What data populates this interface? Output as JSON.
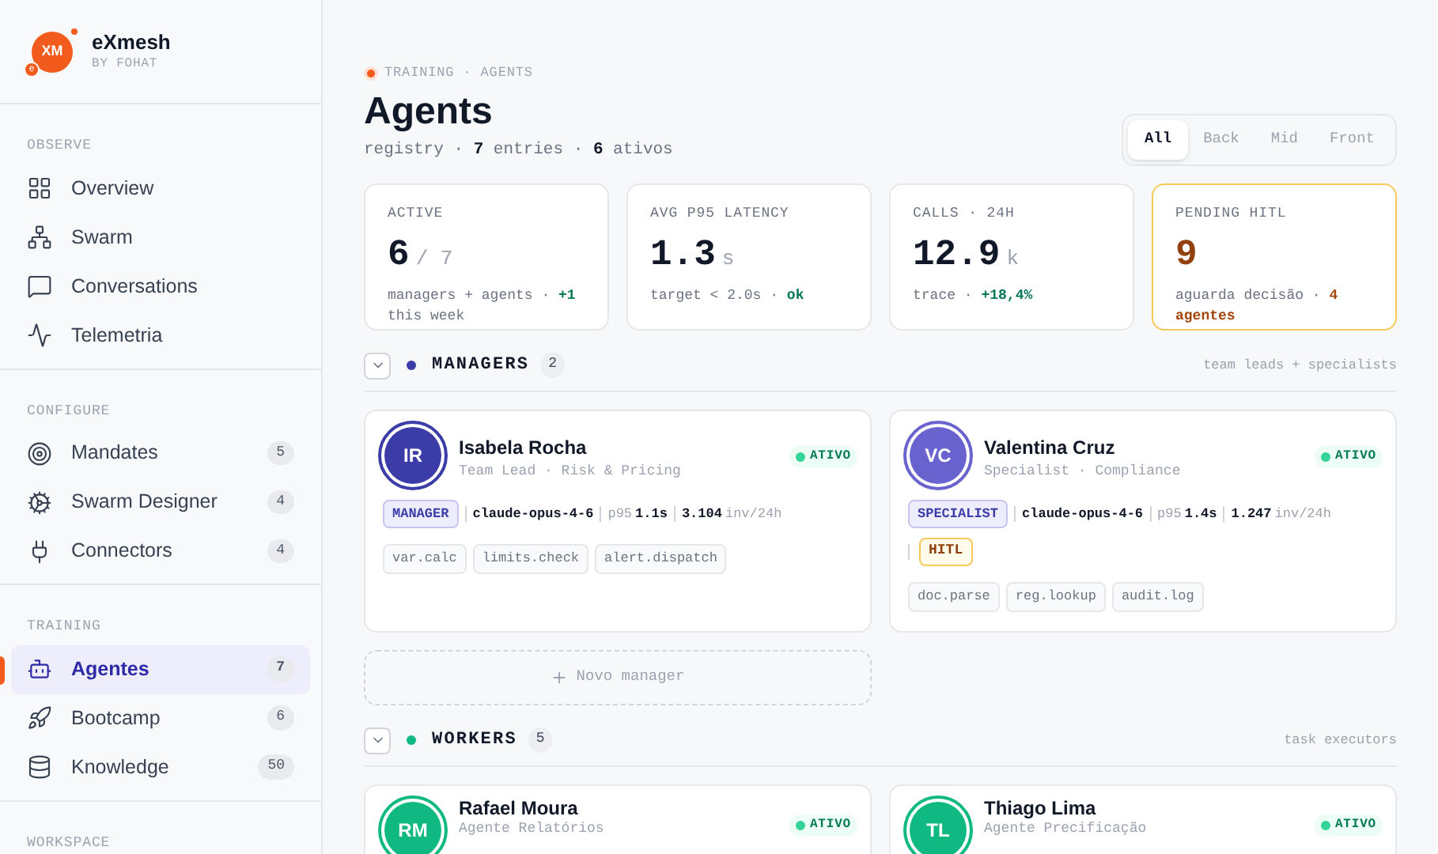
{
  "sidebar": {
    "brand": {
      "logo_text": "XM",
      "logo_badge": "e",
      "name": "eXmesh",
      "byline": "BY FOHAT"
    },
    "sections": [
      {
        "title": "OBSERVE",
        "items": [
          {
            "label": "Overview",
            "selected": false
          },
          {
            "label": "Swarm",
            "selected": false
          },
          {
            "label": "Conversations",
            "selected": false
          },
          {
            "label": "Telemetria",
            "selected": false
          }
        ]
      },
      {
        "title": "CONFIGURE",
        "items": [
          {
            "label": "Mandates",
            "count": "5",
            "selected": false
          },
          {
            "label": "Swarm Designer",
            "count": "4",
            "selected": false
          },
          {
            "label": "Connectors",
            "count": "4",
            "selected": false
          }
        ]
      },
      {
        "title": "TRAINING",
        "items": [
          {
            "label": "Agentes",
            "count": "7",
            "selected": true
          },
          {
            "label": "Bootcamp",
            "count": "6",
            "selected": false
          },
          {
            "label": "Knowledge",
            "count": "50",
            "selected": false
          }
        ]
      },
      {
        "title": "WORKSPACE"
      }
    ]
  },
  "header": {
    "breadcrumb": "TRAINING · AGENTS",
    "title": "Agents",
    "subtitle": "registry · **7** entries · **6** ativos",
    "filters": [
      {
        "label": "All",
        "selected": true
      },
      {
        "label": "Back",
        "selected": false
      },
      {
        "label": "Mid",
        "selected": false
      },
      {
        "label": "Front",
        "selected": false
      }
    ]
  },
  "stats": [
    {
      "label": "ACTIVE",
      "value": "6",
      "unit": "/ 7",
      "note": "managers + agents ·",
      "delta": "+1",
      "note_end": "this week",
      "color": "#047857",
      "highlighted": false
    },
    {
      "label": "AVG P95 LATENCY",
      "value": "1.3",
      "unit": "s",
      "note": "target < 2.0s ·",
      "delta": "ok",
      "color": "#047857",
      "highlighted": false
    },
    {
      "label": "CALLS · 24H",
      "value": "12.9",
      "unit": "k",
      "note": "trace ·",
      "delta": "+18,4%",
      "color": "#047857",
      "highlighted": false
    },
    {
      "label": "PENDING HITL",
      "value": "9",
      "note": "aguarda decisão ·",
      "delta": "4 agentes",
      "color": "#a4460c",
      "highlighted": true
    }
  ],
  "groups": [
    {
      "title": "MANAGERS",
      "count": "2",
      "color": "#3c3ca8",
      "expanded": true,
      "hint": "team leads + specialists",
      "add_label": "Novo manager",
      "agents": [
        {
          "initials": "IR",
          "color": "#3c3ca8",
          "name": "Isabela Rocha",
          "role": "Team Lead · Risk & Pricing",
          "status": "ATIVO",
          "tag": "MANAGER",
          "model": "claude-opus-4-6",
          "p95_label": "p95",
          "p95": "1.1s",
          "invocations": "3.104",
          "inv_unit": "inv/24h",
          "hitl": false,
          "tools": [
            "var.calc",
            "limits.check",
            "alert.dispatch"
          ]
        },
        {
          "initials": "VC",
          "color": "#6963d0",
          "name": "Valentina Cruz",
          "role": "Specialist · Compliance",
          "status": "ATIVO",
          "tag": "SPECIALIST",
          "model": "claude-opus-4-6",
          "p95_label": "p95",
          "p95": "1.4s",
          "invocations": "1.247",
          "inv_unit": "inv/24h",
          "hitl": true,
          "hitl_label": "HITL",
          "tools": [
            "doc.parse",
            "reg.lookup",
            "audit.log"
          ]
        }
      ]
    },
    {
      "title": "WORKERS",
      "count": "5",
      "color": "#10b981",
      "expanded": true,
      "hint": "task executors",
      "agents": [
        {
          "initials": "RM",
          "color": "#10b981",
          "name": "Rafael Moura",
          "role": "Agente Relatórios",
          "status": "ATIVO"
        },
        {
          "initials": "TL",
          "color": "#10b981",
          "name": "Thiago Lima",
          "role": "Agente Precificação",
          "status": "ATIVO"
        }
      ]
    }
  ]
}
